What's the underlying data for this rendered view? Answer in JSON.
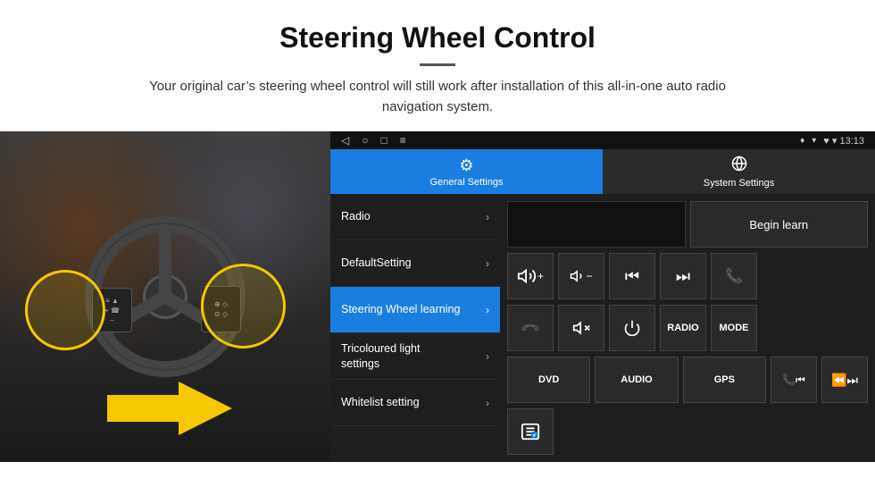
{
  "header": {
    "title": "Steering Wheel Control",
    "divider": true,
    "subtitle": "Your original car’s steering wheel control will still work after installation of this all-in-one auto radio navigation system."
  },
  "screen": {
    "statusBar": {
      "leftIcons": [
        "◁",
        "○",
        "□",
        "≡"
      ],
      "rightText": "♥ ▾ 13:13",
      "locationIcon": "♦"
    },
    "tabs": [
      {
        "label": "General Settings",
        "icon": "⚙",
        "active": true
      },
      {
        "label": "System Settings",
        "icon": "🌐",
        "active": false
      }
    ],
    "menuItems": [
      {
        "label": "Radio",
        "active": false
      },
      {
        "label": "DefaultSetting",
        "active": false
      },
      {
        "label": "Steering Wheel learning",
        "active": true
      },
      {
        "label": "Tricoloured light settings",
        "active": false
      },
      {
        "label": "Whitelist setting",
        "active": false
      }
    ],
    "beginLearnLabel": "Begin learn",
    "controlButtons": {
      "row1": [
        "🔊+",
        "🔊−",
        "⏮",
        "⏭",
        "📞"
      ],
      "row2": [
        "☎",
        "🔇",
        "⏻",
        "RADIO",
        "MODE"
      ],
      "row3": [
        "DVD",
        "AUDIO",
        "GPS",
        "📞⏮",
        "⏪⏭"
      ]
    }
  }
}
